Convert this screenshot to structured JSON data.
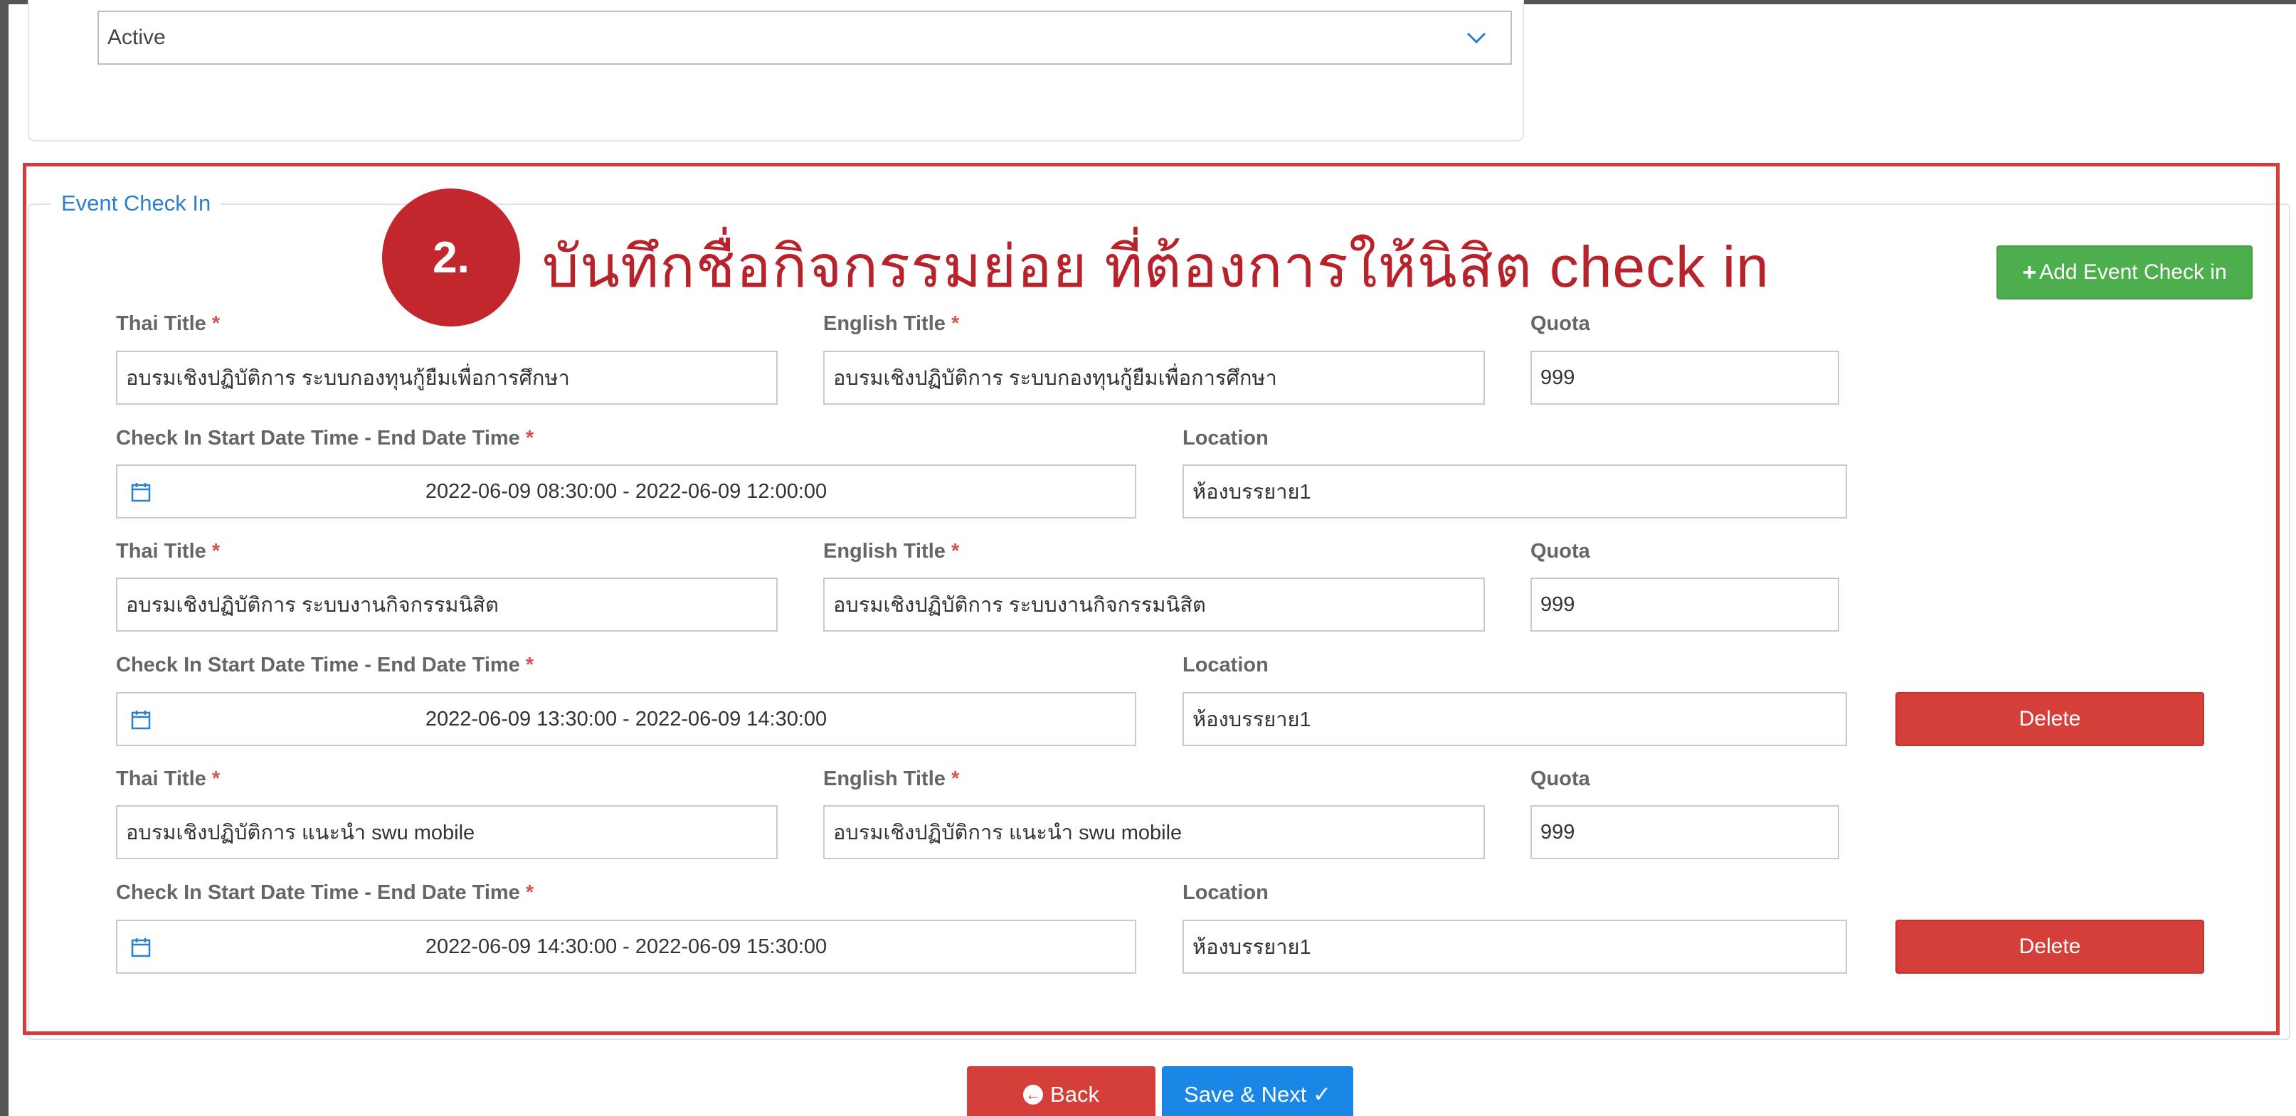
{
  "status": {
    "value": "Active",
    "icon": "chevron-down-icon"
  },
  "event_checkin": {
    "legend": "Event Check In",
    "add_button": "Add Event Check in",
    "annotation": {
      "step": "2.",
      "text": "บันทึกชื่อกิจกรรมย่อย ที่ต้องการให้นิสิต check in"
    },
    "labels": {
      "thai_title": "Thai Title",
      "english_title": "English Title",
      "quota": "Quota",
      "date_range": "Check In Start Date Time - End Date Time",
      "location": "Location",
      "required": "*"
    },
    "delete_label": "Delete",
    "entries": [
      {
        "thai_title": "อบรมเชิงปฏิบัติการ ระบบกองทุนกู้ยืมเพื่อการศึกษา",
        "english_title": "อบรมเชิงปฏิบัติการ ระบบกองทุนกู้ยืมเพื่อการศึกษา",
        "quota": "999",
        "date_range": "2022-06-09 08:30:00 - 2022-06-09 12:00:00",
        "location": "ห้องบรรยาย1"
      },
      {
        "thai_title": "อบรมเชิงปฏิบัติการ ระบบงานกิจกรรมนิสิต",
        "english_title": "อบรมเชิงปฏิบัติการ ระบบงานกิจกรรมนิสิต",
        "quota": "999",
        "date_range": "2022-06-09 13:30:00 - 2022-06-09 14:30:00",
        "location": "ห้องบรรยาย1"
      },
      {
        "thai_title": "อบรมเชิงปฏิบัติการ แนะนำ swu mobile",
        "english_title": "อบรมเชิงปฏิบัติการ แนะนำ swu mobile",
        "quota": "999",
        "date_range": "2022-06-09 14:30:00 - 2022-06-09 15:30:00",
        "location": "ห้องบรรยาย1"
      }
    ]
  },
  "footer": {
    "back_label": "Back",
    "save_label": "Save & Next ✓"
  },
  "colors": {
    "accent": "#2a7fcf",
    "add": "#4cae4c",
    "danger": "#d43f3a",
    "save": "#1a86e6",
    "annotation": "#c1272d"
  }
}
